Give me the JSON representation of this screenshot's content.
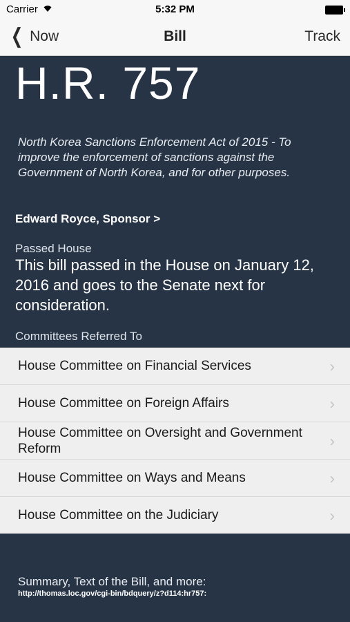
{
  "status_bar": {
    "carrier": "Carrier",
    "time": "5:32 PM"
  },
  "nav": {
    "back_label": "Now",
    "title": "Bill",
    "action_label": "Track"
  },
  "bill": {
    "number": "H.R. 757",
    "description": "North Korea Sanctions Enforcement Act of 2015 - To improve the enforcement of sanctions against the Government of North Korea, and for other purposes.",
    "sponsor_link": "Edward Royce, Sponsor >",
    "status_label": "Passed House",
    "status_text": "This bill passed in the House on January 12, 2016 and goes to the Senate next for consideration."
  },
  "committees": {
    "label": "Committees Referred To",
    "items": [
      {
        "name": "House Committee on Financial Services"
      },
      {
        "name": "House Committee on Foreign Affairs"
      },
      {
        "name": "House Committee on Oversight and Government Reform"
      },
      {
        "name": "House Committee on Ways and Means"
      },
      {
        "name": "House Committee on the Judiciary"
      }
    ]
  },
  "summary": {
    "label": "Summary, Text of the Bill, and more:",
    "url": "http://thomas.loc.gov/cgi-bin/bdquery/z?d114:hr757:"
  },
  "colors": {
    "background": "#263446",
    "bar": "#f7f7f7",
    "list": "#efefef"
  }
}
